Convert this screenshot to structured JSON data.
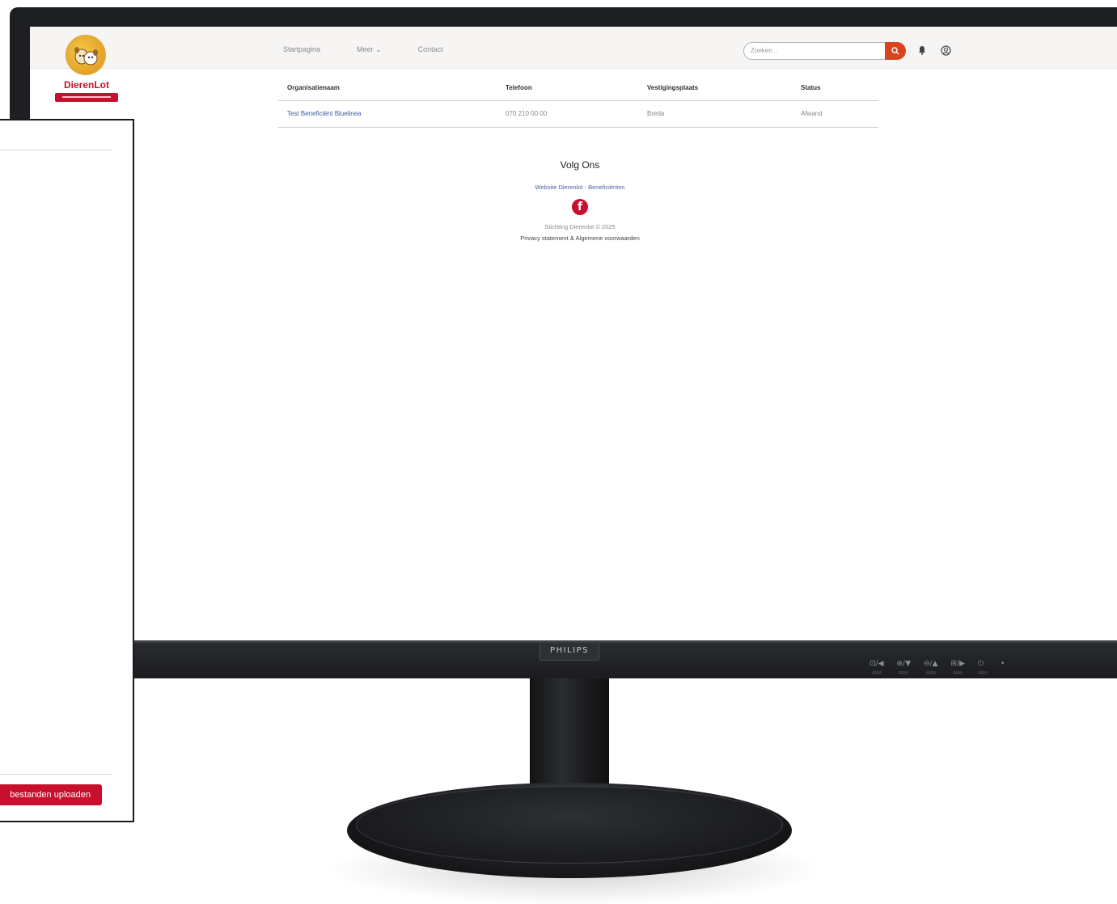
{
  "brand": {
    "name": "DierenLot",
    "accent_color": "#c8102e"
  },
  "nav": {
    "items": [
      "Startpagina",
      "Meer",
      "Contact"
    ],
    "meer_chevron": "chevron-down-icon"
  },
  "search": {
    "placeholder": "Zoeken..."
  },
  "table": {
    "headers": [
      "Organisatienaam",
      "Telefoon",
      "Vestigingsplaats",
      "Status"
    ],
    "rows": [
      [
        "Test Beneficiënt Bluelinea",
        "070 210 00 00",
        "Breda",
        "Afwand"
      ]
    ]
  },
  "footer": {
    "title": "Volg Ons",
    "link": "Website Dierenlot - Beneficiënten",
    "copyright": "Stichting Dierenlot © 2025",
    "privacy": "Privacy statement & Algemene voorwaarden"
  },
  "monitor": {
    "brand": "PHILIPS",
    "osd": [
      "⊡/◀",
      "⊕/▼",
      "⊖/▲",
      "⊞/▶",
      "⏻",
      "•"
    ]
  },
  "panel": {
    "upload_label": "bestanden uploaden"
  }
}
